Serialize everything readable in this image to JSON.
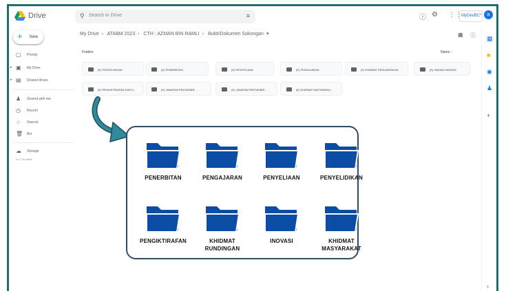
{
  "app": {
    "name": "Drive"
  },
  "header": {
    "search_placeholder": "Search in Drive",
    "account_label": "MyDevBC*",
    "avatar_letter": "a"
  },
  "sidebar": {
    "new_label": "New",
    "items": [
      {
        "label": "Priority",
        "icon": "checkbox-icon"
      },
      {
        "label": "My Drive",
        "icon": "drive-icon"
      },
      {
        "label": "Shared drives",
        "icon": "shared-drive-icon"
      },
      {
        "label": "Shared with me",
        "icon": "people-icon"
      },
      {
        "label": "Recent",
        "icon": "clock-icon"
      },
      {
        "label": "Starred",
        "icon": "star-icon"
      },
      {
        "label": "Bin",
        "icon": "trash-icon"
      },
      {
        "label": "Storage",
        "icon": "cloud-icon"
      }
    ],
    "storage_text": "0.0 / 10 used"
  },
  "breadcrumb": [
    "My Drive",
    "ATABM 2023",
    "CTH : AZMAN BIN RAMLI",
    "Bukti/Dokumen Sokongan"
  ],
  "main": {
    "folders_label": "Folders",
    "sort_label": "Name",
    "folders_row1": [
      "(E) PENYELIDIKAN",
      "(E) PENERBITAN",
      "(E) PENYELIAAN",
      "(E) PENGAJARAN",
      "(F) KHIDMAT PERUNDINGAN",
      "(E) HADIAH INOVASI"
    ],
    "folders_row2": [
      "(E) PENGIKTIRAFAN DAN S...",
      "(E) JAWATAN PENTADBIR...",
      "(E) JAWATAN PENTADBIR...",
      "(E) KHIDMAT MASYARAKA..."
    ]
  },
  "callout": {
    "folder_color": "#0b4ca5",
    "folders": [
      {
        "label": "PENERBITAN"
      },
      {
        "label": "PENGAJARAN"
      },
      {
        "label": "PENYELIAAN"
      },
      {
        "label": "PENYELIDIKAN"
      },
      {
        "label": "PENGIKTIRAFAN"
      },
      {
        "label": "KHIDMAT RUNDINGAN",
        "line1": "KHIDMAT",
        "line2": "RUNDINGAN"
      },
      {
        "label": "INOVASI"
      },
      {
        "label": "KHIDMAT MASYARAKAT",
        "line1": "KHIDMAT",
        "line2": "MASYARAKAT"
      }
    ]
  },
  "colors": {
    "frame": "#1f6d70",
    "arrow": "#2f8a9b",
    "callout_border": "#2b4e6d"
  }
}
